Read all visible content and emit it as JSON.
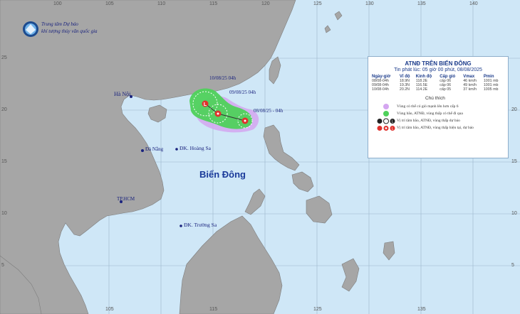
{
  "agency": {
    "line1": "Trung tâm Dự báo",
    "line2": "khí tượng thủy văn quốc gia"
  },
  "grid": {
    "lon_labels": [
      "100",
      "105",
      "110",
      "115",
      "120",
      "125",
      "130",
      "135",
      "140"
    ],
    "lat_labels": [
      "25",
      "20",
      "15",
      "10",
      "5"
    ]
  },
  "places": {
    "hanoi": "Hà Nội",
    "danang": "Đà Nẵng",
    "hcm": "TP.HCM",
    "hoangsa": "ĐK. Hoàng Sa",
    "truongsa": "ĐK. Trường Sa",
    "bien_dong": "Biển Đông"
  },
  "track_labels": {
    "p1": "08/08/25 - 04h",
    "p2": "09/08/25   04h",
    "p3": "10/08/25   04h"
  },
  "info": {
    "title": "ATNĐ TRÊN BIỂN ĐÔNG",
    "issued": "Tin phát lúc: 05 giờ 00 phút, 08/08/2025",
    "headers": [
      "Ngày-giờ",
      "Vĩ độ",
      "Kinh độ",
      "Cấp gió",
      "Vmax",
      "Pmin"
    ],
    "rows": [
      [
        "08/08-04h",
        "18.9N",
        "118.2E",
        "cấp 06",
        "46 km/h",
        "1001 mb"
      ],
      [
        "09/08-04h",
        "19.3N",
        "116.5E",
        "cấp 06",
        "49 km/h",
        "1001 mb"
      ],
      [
        "10/08-04h",
        "20.2N",
        "114.2E",
        "cấp 05",
        "37 km/h",
        "1005 mb"
      ]
    ],
    "legend_title": "Chú thích",
    "legend": [
      "Vùng có thể có gió mạnh lên hơn cấp 6",
      "Vùng bão, ATNĐ, vùng thấp có thể đi qua",
      "Vị trí tâm bão, ATNĐ, vùng thấp dự báo",
      "Vị trí tâm bão, ATNĐ, vùng thấp hiện tại, dự báo"
    ]
  },
  "colors": {
    "sea": "#cfe7f7",
    "land": "#a6a6a6",
    "wind_zone": "#d4a6f0",
    "storm_zone": "#4fd15b",
    "center": "#e0312d"
  }
}
